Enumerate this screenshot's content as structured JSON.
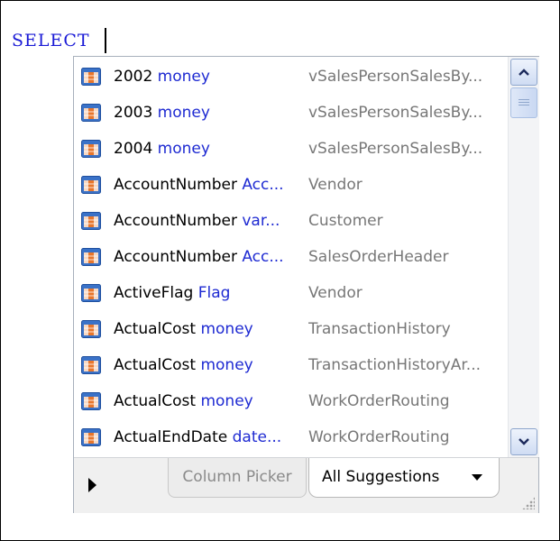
{
  "editor": {
    "keyword": "SELECT"
  },
  "suggestions": [
    {
      "column": "2002",
      "type": "money",
      "table": "vSalesPersonSalesBy..."
    },
    {
      "column": "2003",
      "type": "money",
      "table": "vSalesPersonSalesBy..."
    },
    {
      "column": "2004",
      "type": "money",
      "table": "vSalesPersonSalesBy..."
    },
    {
      "column": "AccountNumber",
      "type": "Acc...",
      "table": "Vendor"
    },
    {
      "column": "AccountNumber",
      "type": "var...",
      "table": "Customer"
    },
    {
      "column": "AccountNumber",
      "type": "Acc...",
      "table": "SalesOrderHeader"
    },
    {
      "column": "ActiveFlag",
      "type": "Flag",
      "table": "Vendor"
    },
    {
      "column": "ActualCost",
      "type": "money",
      "table": "TransactionHistory"
    },
    {
      "column": "ActualCost",
      "type": "money",
      "table": "TransactionHistoryAr..."
    },
    {
      "column": "ActualCost",
      "type": "money",
      "table": "WorkOrderRouting"
    },
    {
      "column": "ActualEndDate",
      "type": "date...",
      "table": "WorkOrderRouting"
    }
  ],
  "footer": {
    "tab_column_picker": "Column Picker",
    "tab_all_suggestions": "All Suggestions"
  },
  "icons": {
    "column": "table-column-icon",
    "scroll_up": "arrow-up-icon",
    "scroll_down": "arrow-down-icon",
    "expand": "play-icon",
    "dropdown": "dropdown-arrow-icon",
    "resize": "resize-grip-icon"
  },
  "colors": {
    "keyword": "#1a1ad6",
    "type": "#1e2ad2",
    "table": "#777777"
  }
}
